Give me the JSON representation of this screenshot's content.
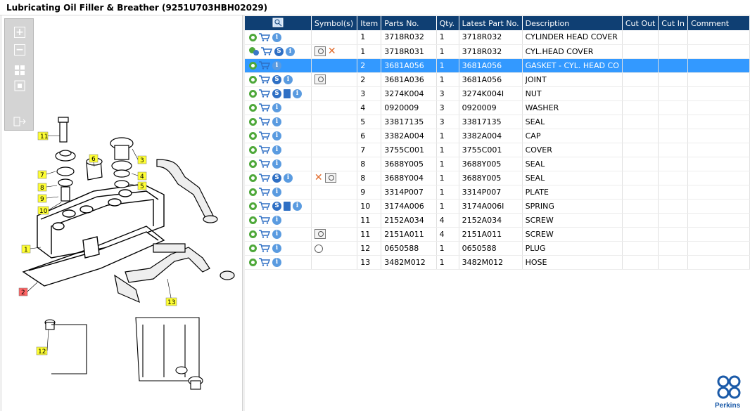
{
  "title": "Lubricating Oil Filler & Breather (9251U703HBH02029)",
  "toolbar": {
    "zoom_in": "+",
    "zoom_out": "−"
  },
  "columns": [
    "Symbol(s)",
    "Item",
    "Parts No.",
    "Qty.",
    "Latest Part No.",
    "Description",
    "Cut Out",
    "Cut In",
    "Comment"
  ],
  "rows": [
    {
      "item": "1",
      "part": "3718R032",
      "qty": "1",
      "latest": "3718R032",
      "desc": "CYLINDER HEAD COVER",
      "icons": [
        "gear",
        "cart",
        "info"
      ],
      "symbols": []
    },
    {
      "item": "1",
      "part": "3718R031",
      "qty": "1",
      "latest": "3718R032",
      "desc": "CYL.HEAD COVER",
      "icons": [
        "gear2",
        "cart",
        "s",
        "info"
      ],
      "symbols": [
        "sym",
        "x"
      ]
    },
    {
      "item": "2",
      "part": "3681A056",
      "qty": "1",
      "latest": "3681A056",
      "desc": "GASKET - CYL. HEAD CO",
      "icons": [
        "gear",
        "cart",
        "info"
      ],
      "symbols": [],
      "selected": true
    },
    {
      "item": "2",
      "part": "3681A036",
      "qty": "1",
      "latest": "3681A056",
      "desc": "JOINT",
      "icons": [
        "gear",
        "cart",
        "s",
        "info"
      ],
      "symbols": [
        "sym"
      ]
    },
    {
      "item": "3",
      "part": "3274K004",
      "qty": "3",
      "latest": "3274K004I",
      "desc": "NUT",
      "icons": [
        "gear",
        "cart",
        "s",
        "book",
        "info"
      ],
      "symbols": []
    },
    {
      "item": "4",
      "part": "0920009",
      "qty": "3",
      "latest": "0920009",
      "desc": "WASHER",
      "icons": [
        "gear",
        "cart",
        "info"
      ],
      "symbols": []
    },
    {
      "item": "5",
      "part": "33817135",
      "qty": "3",
      "latest": "33817135",
      "desc": "SEAL",
      "icons": [
        "gear",
        "cart",
        "info"
      ],
      "symbols": []
    },
    {
      "item": "6",
      "part": "3382A004",
      "qty": "1",
      "latest": "3382A004",
      "desc": "CAP",
      "icons": [
        "gear",
        "cart",
        "info"
      ],
      "symbols": []
    },
    {
      "item": "7",
      "part": "3755C001",
      "qty": "1",
      "latest": "3755C001",
      "desc": "COVER",
      "icons": [
        "gear",
        "cart",
        "info"
      ],
      "symbols": []
    },
    {
      "item": "8",
      "part": "3688Y005",
      "qty": "1",
      "latest": "3688Y005",
      "desc": "SEAL",
      "icons": [
        "gear",
        "cart",
        "info"
      ],
      "symbols": []
    },
    {
      "item": "8",
      "part": "3688Y004",
      "qty": "1",
      "latest": "3688Y005",
      "desc": "SEAL",
      "icons": [
        "gear",
        "cart",
        "s",
        "info"
      ],
      "symbols": [
        "x",
        "sym"
      ]
    },
    {
      "item": "9",
      "part": "3314P007",
      "qty": "1",
      "latest": "3314P007",
      "desc": "PLATE",
      "icons": [
        "gear",
        "cart",
        "info"
      ],
      "symbols": []
    },
    {
      "item": "10",
      "part": "3174A006",
      "qty": "1",
      "latest": "3174A006I",
      "desc": "SPRING",
      "icons": [
        "gear",
        "cart",
        "s",
        "book",
        "info"
      ],
      "symbols": []
    },
    {
      "item": "11",
      "part": "2152A034",
      "qty": "4",
      "latest": "2152A034",
      "desc": "SCREW",
      "icons": [
        "gear",
        "cart",
        "info"
      ],
      "symbols": []
    },
    {
      "item": "11",
      "part": "2151A011",
      "qty": "4",
      "latest": "2151A011",
      "desc": "SCREW",
      "icons": [
        "gear",
        "cart",
        "info"
      ],
      "symbols": [
        "sym"
      ]
    },
    {
      "item": "12",
      "part": "0650588",
      "qty": "1",
      "latest": "0650588",
      "desc": "PLUG",
      "icons": [
        "gear",
        "cart",
        "info"
      ],
      "symbols": [
        "pin"
      ]
    },
    {
      "item": "13",
      "part": "3482M012",
      "qty": "1",
      "latest": "3482M012",
      "desc": "HOSE",
      "icons": [
        "gear",
        "cart",
        "info"
      ],
      "symbols": []
    }
  ],
  "callouts": [
    "1",
    "2",
    "3",
    "4",
    "5",
    "6",
    "7",
    "8",
    "9",
    "10",
    "11",
    "12",
    "13"
  ],
  "brand": {
    "name": "Perkins",
    "color": "#1b5aa8"
  },
  "colors": {
    "header": "#0f3f73",
    "selected": "#3399ff",
    "callout": "#ffff33",
    "callout_highlight": "#ff6666"
  }
}
